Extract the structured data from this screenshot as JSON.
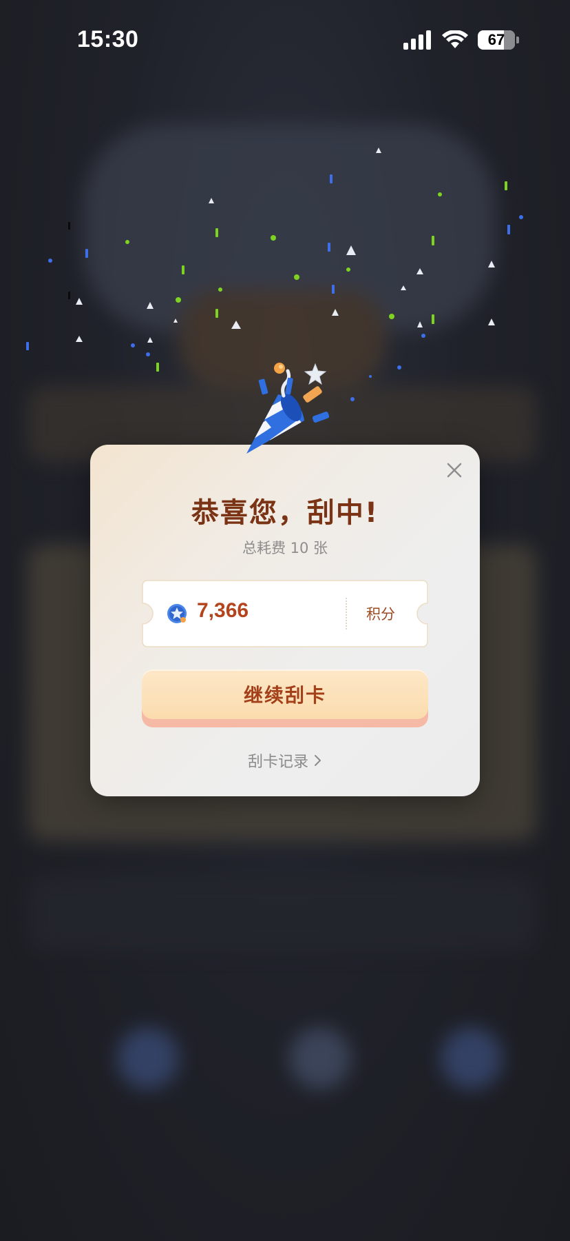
{
  "status_bar": {
    "time": "15:30",
    "battery": "67"
  },
  "dialog": {
    "title": "恭喜您，刮中!",
    "subtitle": "总耗费 10 张",
    "reward": {
      "amount": "7,366",
      "unit": "积分"
    },
    "continue_label": "继续刮卡",
    "record_label": "刮卡记录"
  },
  "icons": {
    "close": "close-icon",
    "coin": "star-coin-icon",
    "chevron": "chevron-right-icon",
    "popper": "party-popper-icon",
    "signal": "signal-icon",
    "wifi": "wifi-icon",
    "battery": "battery-icon"
  },
  "colors": {
    "title": "#7a3314",
    "amount": "#b4441c",
    "button_face": "#fbdcae",
    "button_shadow": "#f6b9a5",
    "confetti_blue": "#3f6fe8",
    "confetti_green": "#7ed321"
  }
}
